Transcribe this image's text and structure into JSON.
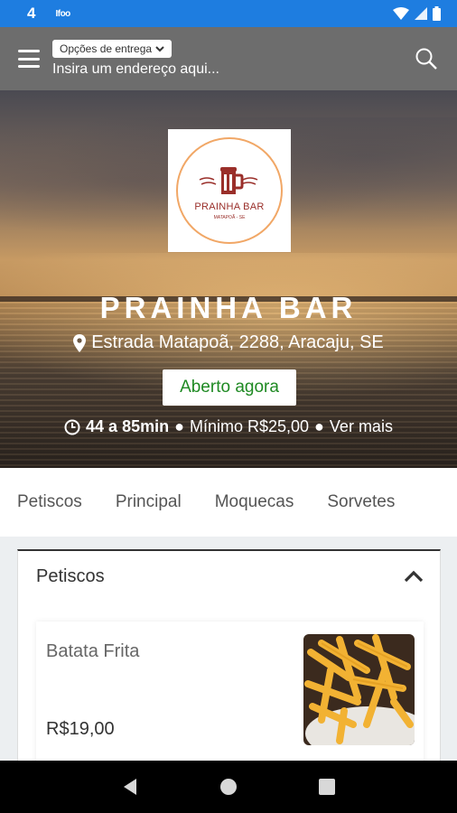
{
  "status_bar": {
    "time": "4",
    "app_badge": "Ifoo"
  },
  "app_bar": {
    "delivery_options_label": "Opções de entrega",
    "address_placeholder": "Insira um endereço aqui..."
  },
  "hero": {
    "logo_title": "PRAINHA BAR",
    "logo_subtitle": "MATAPOÃ - SE",
    "restaurant_name": "PRAINHA BAR",
    "address": "Estrada Matapoã, 2288, Aracaju, SE",
    "status_badge": "Aberto agora",
    "delivery_time": "44 a 85min",
    "bullet": "●",
    "minimum_order": "Mínimo R$25,00",
    "see_more": "Ver mais"
  },
  "tabs": [
    "Petiscos",
    "Principal",
    "Moquecas",
    "Sorvetes"
  ],
  "section": {
    "title": "Petiscos",
    "items": [
      {
        "name": "Batata Frita",
        "price": "R$19,00"
      }
    ]
  },
  "colors": {
    "status_bar": "#1e7de0",
    "app_bar": "#6d6d6d",
    "open_badge_text": "#1f8a23",
    "logo_accent": "#9a2f2a"
  },
  "icons": [
    "menu-icon",
    "search-icon",
    "chevron-down-icon",
    "map-pin-icon",
    "clock-icon",
    "chevron-up-icon",
    "back-icon",
    "home-icon",
    "recents-icon"
  ]
}
